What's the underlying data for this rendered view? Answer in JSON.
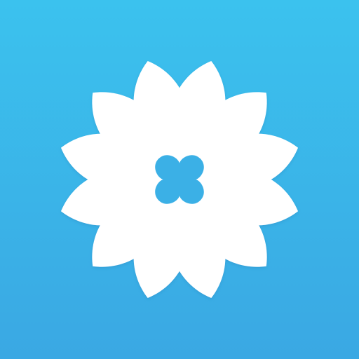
{
  "icon": {
    "name": "flower-app-icon",
    "colors": {
      "background_top": "#3bc2ee",
      "background_bottom": "#3aa8e3",
      "petals": "#ffffff",
      "center_cutout": "#3bb0e6",
      "petal_shadow": "#2a86bf"
    }
  }
}
